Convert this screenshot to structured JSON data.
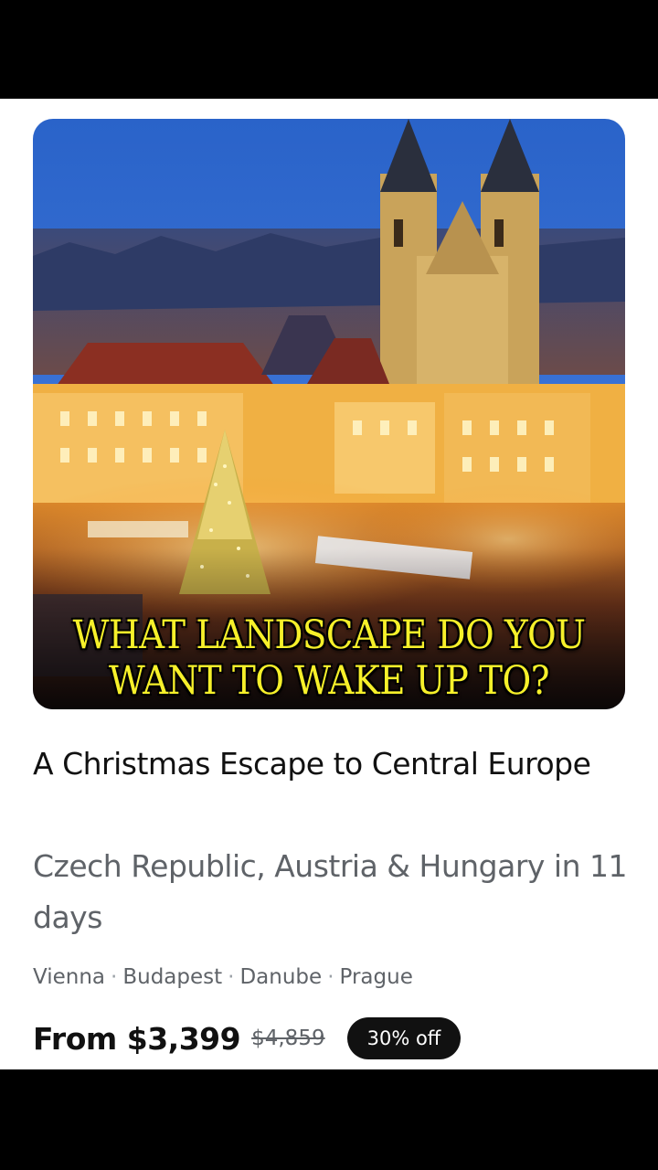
{
  "hero": {
    "caption_line1": "WHAT LANDSCAPE DO YOU",
    "caption_line2": "WANT TO WAKE UP TO?"
  },
  "trip": {
    "title": "A Christmas Escape to Central Europe",
    "subtitle": "Czech Republic, Austria & Hungary in 11 days",
    "stops": [
      "Vienna",
      "Budapest",
      "Danube",
      "Prague"
    ],
    "price_label": "From $3,399",
    "original_price": "$4,859",
    "discount_badge": "30% off"
  },
  "colors": {
    "caption": "#f6f02a",
    "badge_bg": "#111111",
    "muted_text": "#5f6368"
  }
}
